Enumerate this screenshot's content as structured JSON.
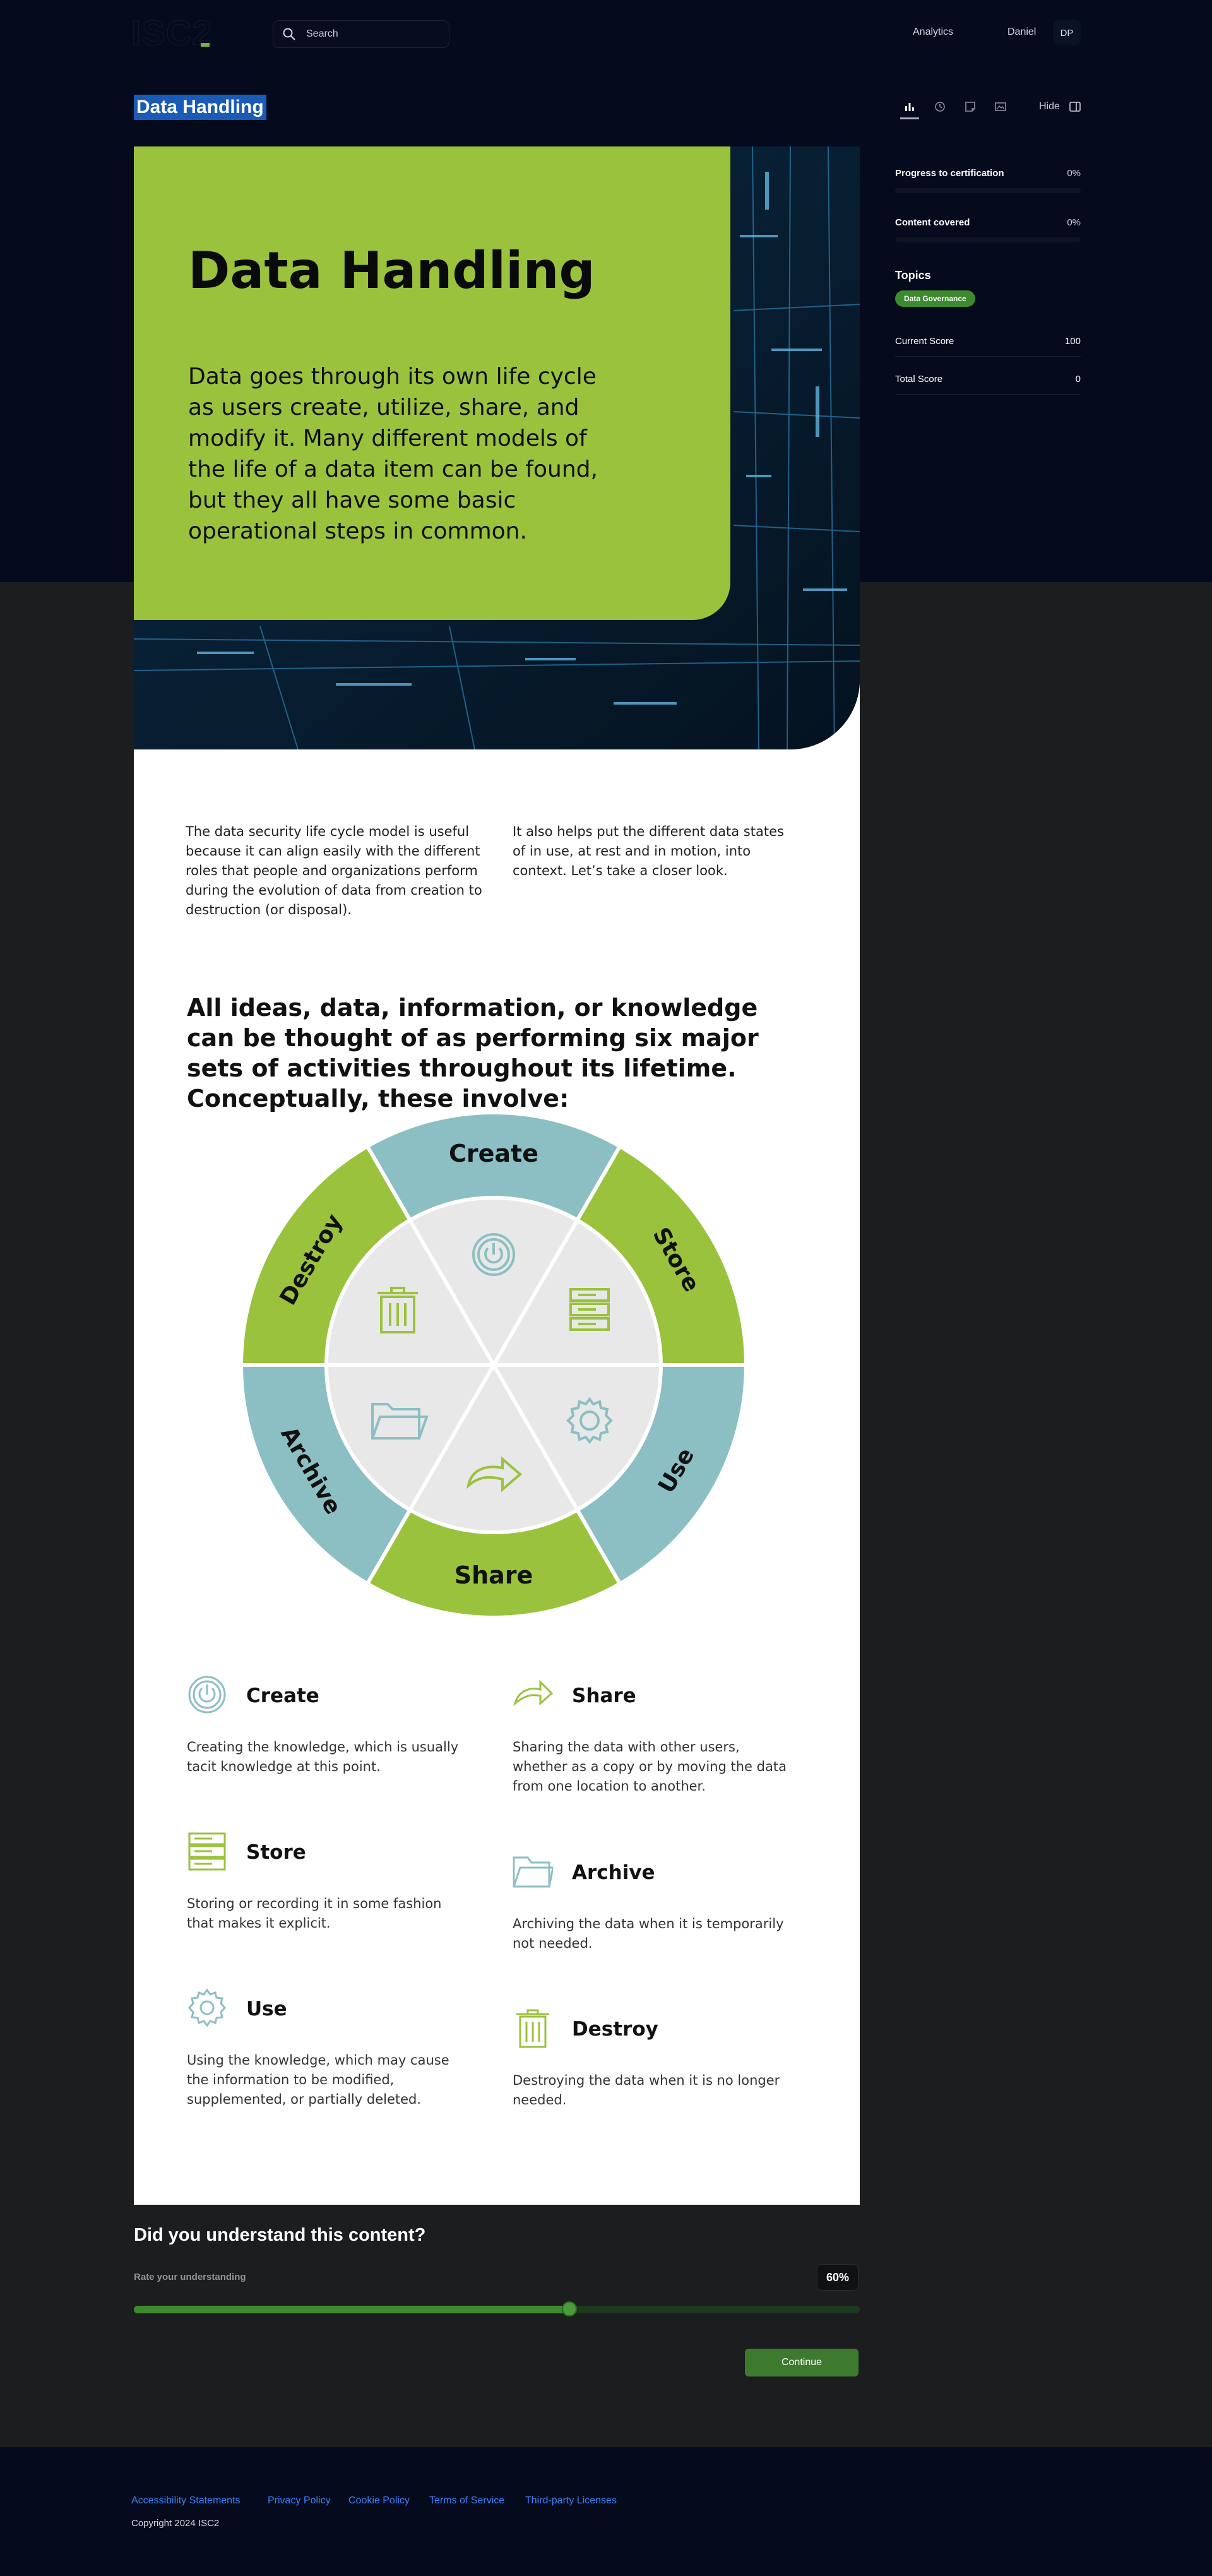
{
  "header": {
    "logo": "ISC2",
    "search_placeholder": "Search",
    "nav_analytics": "Analytics",
    "user_name": "Daniel",
    "avatar_initials": "DP"
  },
  "toolbar": {
    "hide_label": "Hide",
    "icons": [
      "bar-chart-icon",
      "history-icon",
      "note-icon",
      "image-icon",
      "collapse-panel-icon"
    ]
  },
  "page": {
    "title": "Data Handling"
  },
  "sidebar": {
    "progress_label": "Progress to certification",
    "progress_value": "0%",
    "progress_fraction": 0,
    "content_label": "Content covered",
    "content_value": "0%",
    "content_fraction": 0,
    "topics_label": "Topics",
    "topic_chip": "Data Governance",
    "current_score_label": "Current Score",
    "current_score_value": "100",
    "total_score_label": "Total Score",
    "total_score_value": "0"
  },
  "hero": {
    "title": "Data Handling",
    "text": "Data goes through its own life cycle as users create, utilize, share, and modify it. Many different models of the life of a data item can be found, but they all have some basic operational steps in common."
  },
  "intro": {
    "left": "The data security life cycle model is useful because it can align easily with the different roles that people and organizations perform during the evolution of data from creation to destruction (or disposal).",
    "right": "It also helps put the different data states of in use, at rest and in motion, into context. Let’s take a closer look."
  },
  "lead": "All ideas, data, information, or knowledge can be thought of as performing six major sets of activities throughout its lifetime. Conceptually, these involve:",
  "wheel": {
    "labels": [
      "Create",
      "Store",
      "Use",
      "Share",
      "Archive",
      "Destroy"
    ]
  },
  "stages": {
    "create": {
      "name": "Create",
      "desc": "Creating the knowledge, which is usually tacit knowledge at this point."
    },
    "share": {
      "name": "Share",
      "desc": "Sharing the data with other users, whether as a copy or by moving the data from one location to another."
    },
    "store": {
      "name": "Store",
      "desc": "Storing or recording it in some fashion that makes it explicit."
    },
    "archive": {
      "name": "Archive",
      "desc": "Archiving the data when it is temporarily not needed."
    },
    "use": {
      "name": "Use",
      "desc": "Using the knowledge, which may cause the information to be modified, supplemented, or partially deleted."
    },
    "destroy": {
      "name": "Destroy",
      "desc": "Destroying the data when it is no longer needed."
    }
  },
  "feedback": {
    "title": "Did you understand this content?",
    "rate_label": "Rate your understanding",
    "value_text": "60%",
    "value_fraction": 0.6,
    "continue_label": "Continue"
  },
  "footer": {
    "links": [
      "Accessibility Statements",
      "Privacy Policy",
      "Cookie Policy",
      "Terms of Service",
      "Third-party Licenses"
    ],
    "copyright": "Copyright 2024 ISC2"
  },
  "colors": {
    "accent_green": "#9ac23c",
    "teal": "#8bbfc3",
    "dark_bg": "#050b1d",
    "button_green": "#3d7a2e"
  }
}
